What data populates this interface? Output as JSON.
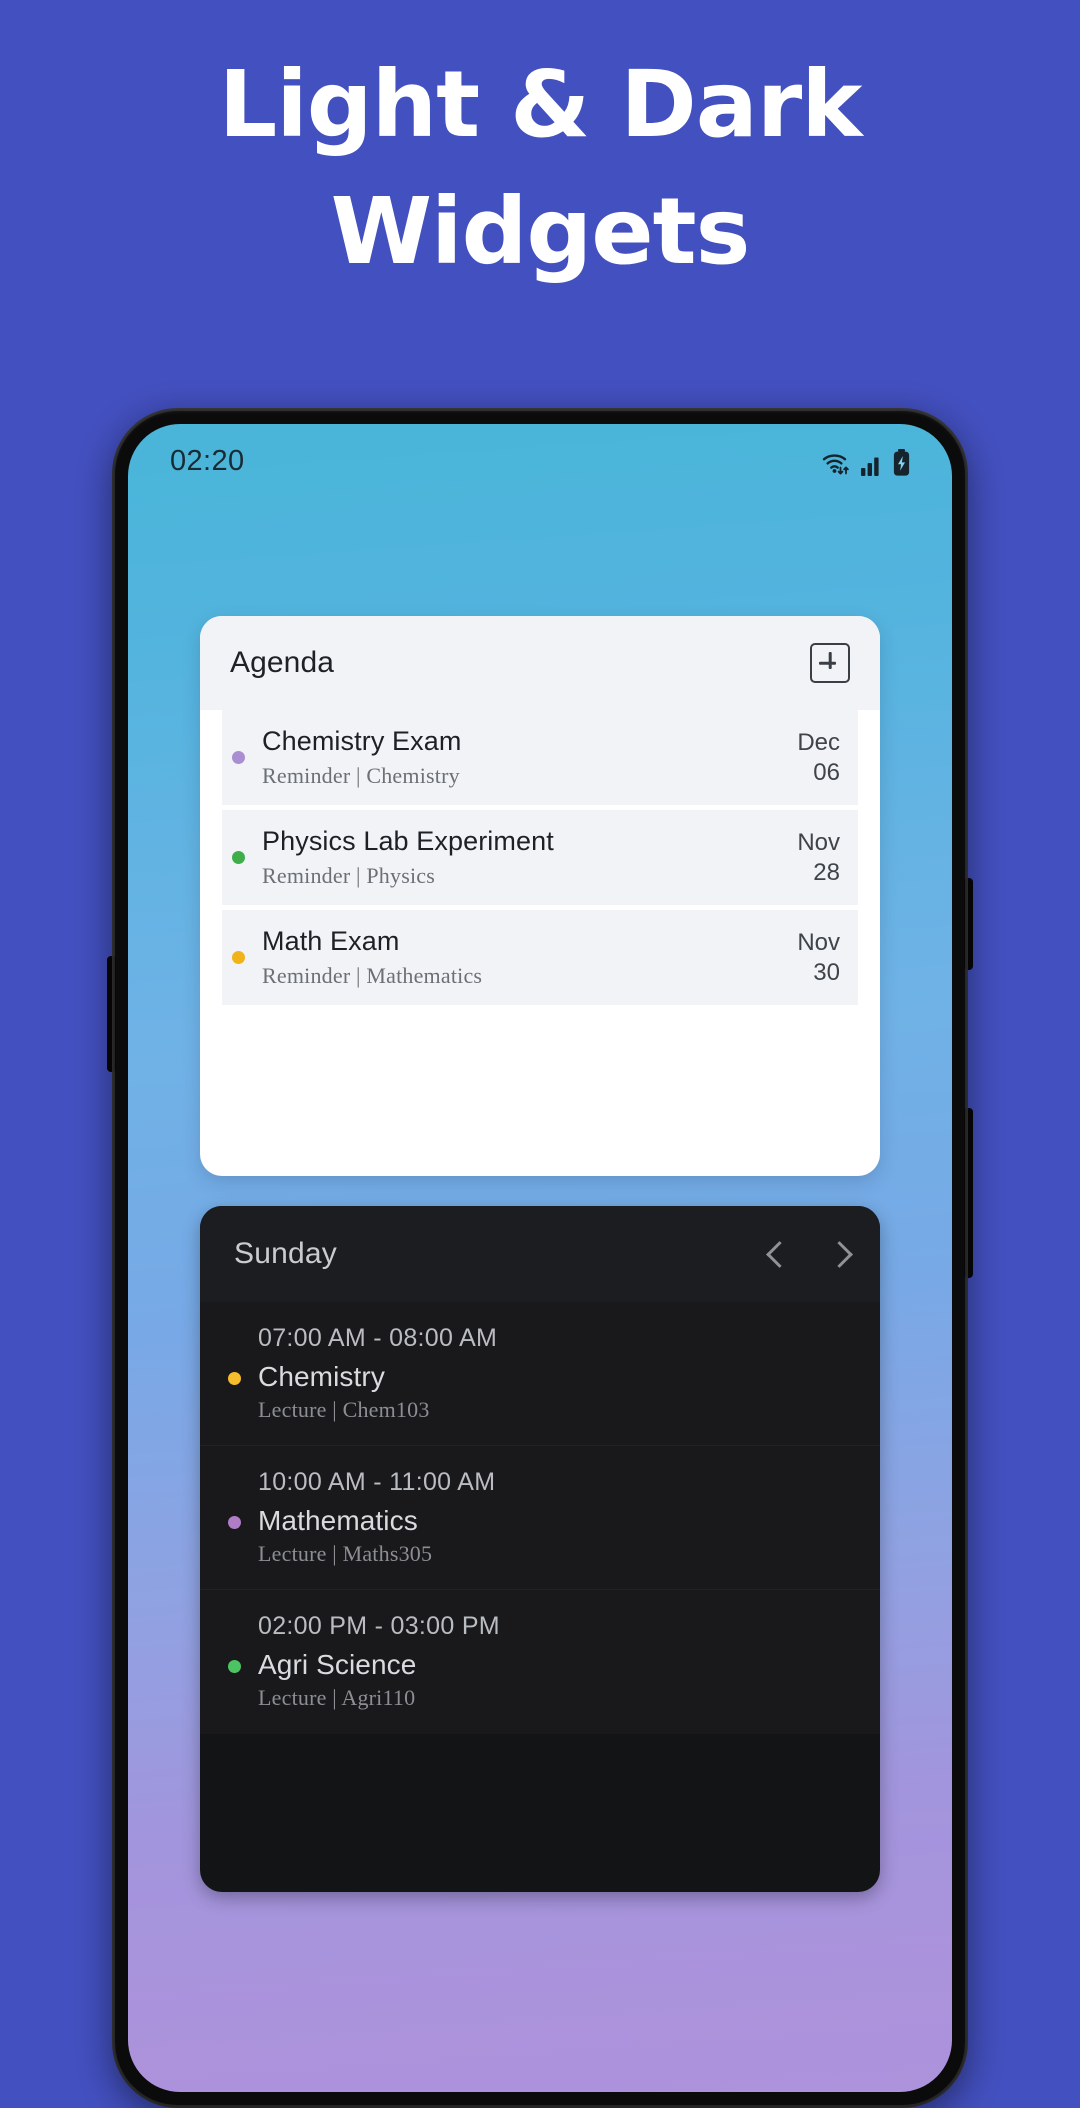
{
  "promo": {
    "line1": "Light & Dark",
    "line2": "Widgets",
    "background_color": "#4350bf",
    "text_color": "#ffffff"
  },
  "status_bar": {
    "time": "02:20",
    "icons": [
      "wifi-icon",
      "cellular-signal-icon",
      "battery-charging-icon"
    ]
  },
  "agenda_widget": {
    "title": "Agenda",
    "add_icon": "plus-square-icon",
    "items": [
      {
        "title": "Chemistry Exam",
        "subtitle": "Reminder | Chemistry",
        "date": "Dec\n06",
        "dot_color": "#a98fd1"
      },
      {
        "title": "Physics Lab Experiment",
        "subtitle": "Reminder | Physics",
        "date": "Nov\n28",
        "dot_color": "#3fae4a"
      },
      {
        "title": "Math Exam",
        "subtitle": "Reminder | Mathematics",
        "date": "Nov\n30",
        "dot_color": "#f0b418"
      }
    ]
  },
  "schedule_widget": {
    "day": "Sunday",
    "prev_icon": "chevron-left-icon",
    "next_icon": "chevron-right-icon",
    "items": [
      {
        "time": "07:00 AM - 08:00 AM",
        "title": "Chemistry",
        "subtitle": "Lecture | Chem103",
        "dot_color": "#f5bc2e"
      },
      {
        "time": "10:00 AM - 11:00 AM",
        "title": "Mathematics",
        "subtitle": "Lecture | Maths305",
        "dot_color": "#b07cc6"
      },
      {
        "time": "02:00 PM - 03:00 PM",
        "title": "Agri Science",
        "subtitle": "Lecture | Agri110",
        "dot_color": "#4cc463"
      }
    ]
  }
}
